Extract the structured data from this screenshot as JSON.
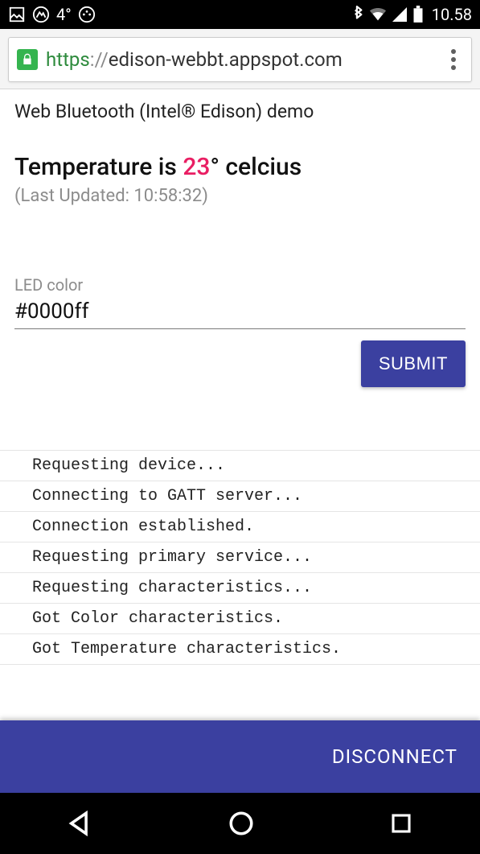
{
  "status_bar": {
    "temperature": "4°",
    "time": "10.58"
  },
  "browser": {
    "url_scheme": "https",
    "url_sep": "://",
    "url_host": "edison-webbt.appspot.com"
  },
  "page": {
    "demo_title": "Web Bluetooth (Intel® Edison) demo",
    "temp_prefix": "Temperature is ",
    "temp_value": "23",
    "temp_suffix": "° celcius",
    "last_updated": "(Last Updated: 10:58:32)",
    "led_label": "LED color",
    "led_value": "#0000ff",
    "submit_label": "SUBMIT",
    "disconnect_label": "DISCONNECT"
  },
  "log": [
    "Requesting device...",
    "Connecting to GATT server...",
    "Connection established.",
    "Requesting primary service...",
    "Requesting characteristics...",
    "Got Color characteristics.",
    "Got Temperature characteristics."
  ]
}
